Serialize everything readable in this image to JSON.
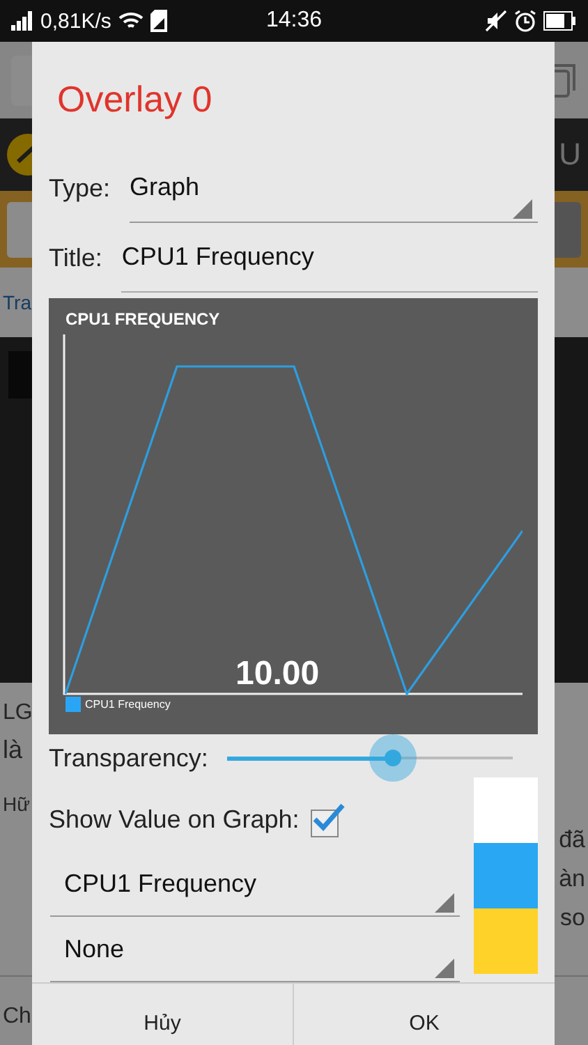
{
  "status_bar": {
    "network_speed": "0,81K/s",
    "time": "14:36"
  },
  "site_nav": {
    "menu": "U"
  },
  "breadcrumb": "Tra",
  "article_edges": {
    "left": [
      "LG",
      "là",
      "Hữ"
    ],
    "right": [
      "đã",
      "àn",
      "so"
    ]
  },
  "next_article": "Ch",
  "dialog": {
    "title": "Overlay 0",
    "type": {
      "label": "Type:",
      "value": "Graph"
    },
    "title_field": {
      "label": "Title:",
      "value": "CPU1 Frequency"
    },
    "graph": {
      "title": "CPU1 FREQUENCY",
      "value": "10.00",
      "legend": "CPU1 Frequency"
    },
    "transparency": {
      "label": "Transparency:",
      "level": 0.58
    },
    "show_value": {
      "label": "Show Value on Graph:",
      "checked": true
    },
    "selectors": [
      {
        "value": "CPU1 Frequency"
      },
      {
        "value": "None"
      }
    ],
    "swatches": [
      {
        "color": "#ffffff"
      },
      {
        "color": "#29a7f2"
      },
      {
        "color": "#ffd22a"
      }
    ],
    "buttons": [
      "Hủy",
      "OK"
    ]
  }
}
